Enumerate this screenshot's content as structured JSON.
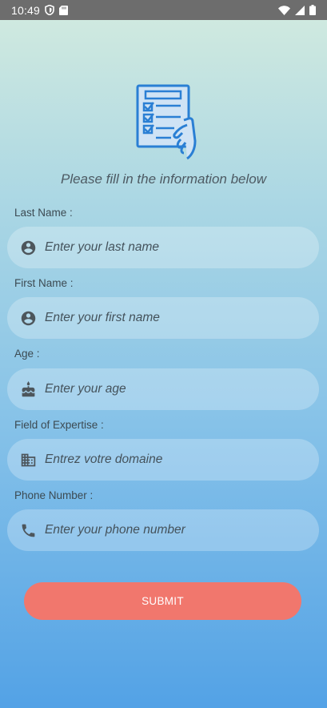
{
  "status_bar": {
    "time": "10:49"
  },
  "form": {
    "subtitle": "Please fill in the information below",
    "fields": [
      {
        "label": "Last Name :",
        "placeholder": "Enter your last name",
        "icon": "account-circle-icon"
      },
      {
        "label": "First Name :",
        "placeholder": "Enter your first name",
        "icon": "account-circle-icon"
      },
      {
        "label": "Age :",
        "placeholder": "Enter your age",
        "icon": "cake-icon"
      },
      {
        "label": "Field of Expertise :",
        "placeholder": "Entrez votre domaine",
        "icon": "building-icon"
      },
      {
        "label": "Phone Number :",
        "placeholder": "Enter your phone number",
        "icon": "phone-icon"
      }
    ],
    "submit_label": "SUBMIT"
  },
  "colors": {
    "submit": "#f1776d",
    "status_bar": "#6d6d6d",
    "icon_blue": "#2a7fd4"
  }
}
